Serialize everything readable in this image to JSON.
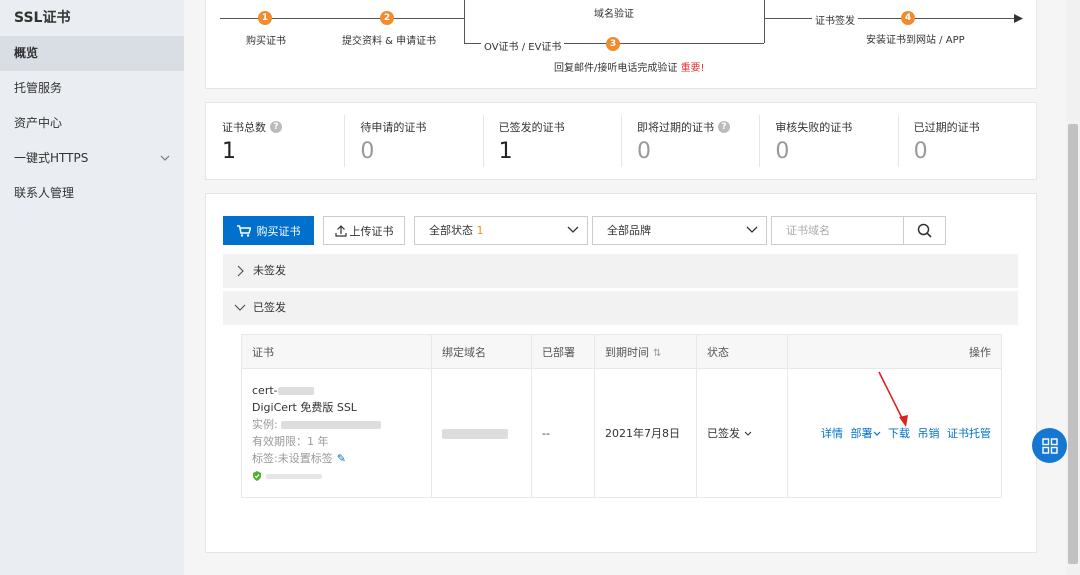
{
  "sidebar": {
    "title": "SSL证书",
    "items": [
      {
        "label": "概览",
        "active": true
      },
      {
        "label": "托管服务"
      },
      {
        "label": "资产中心"
      },
      {
        "label": "一键式HTTPS"
      },
      {
        "label": "联系人管理"
      }
    ]
  },
  "flow": {
    "steps": [
      {
        "num": "1",
        "label": "购买证书"
      },
      {
        "num": "2",
        "label": "提交资料 & 申请证书"
      },
      {
        "num": "3",
        "label": "回复邮件/接听电话完成验证",
        "tag": "重要!"
      },
      {
        "num": "4",
        "label": "安装证书到网站 / APP"
      }
    ],
    "domain_verify": "域名验证",
    "ov_ev": "OV证书 / EV证书",
    "issue": "证书签发"
  },
  "stats": [
    {
      "label": "证书总数",
      "value": "1",
      "help": true
    },
    {
      "label": "待申请的证书",
      "value": "0"
    },
    {
      "label": "已签发的证书",
      "value": "1"
    },
    {
      "label": "即将过期的证书",
      "value": "0",
      "help": true
    },
    {
      "label": "审核失败的证书",
      "value": "0"
    },
    {
      "label": "已过期的证书",
      "value": "0"
    }
  ],
  "toolbar": {
    "buy_label": "购买证书",
    "upload_label": "上传证书",
    "status_select": "全部状态",
    "status_count": "1",
    "brand_select": "全部品牌",
    "search_placeholder": "证书域名"
  },
  "groups": {
    "unissued": "未签发",
    "issued": "已签发"
  },
  "table": {
    "headers": [
      "证书",
      "绑定域名",
      "已部署",
      "到期时间",
      "状态",
      "操作"
    ],
    "row": {
      "cert_prefix": "cert-",
      "product": "DigiCert 免费版 SSL",
      "instance_label": "实例:",
      "validity": "有效期限：1 年",
      "tag": "标签:未设置标签",
      "deployed": "--",
      "expiry": "2021年7月8日",
      "status": "已签发",
      "actions": [
        "详情",
        "部署",
        "下载",
        "吊销",
        "证书托管"
      ]
    }
  },
  "colors": {
    "primary": "#0070cc",
    "step": "#f08c2e",
    "important": "#e4393c",
    "annotation": "#e02020"
  }
}
